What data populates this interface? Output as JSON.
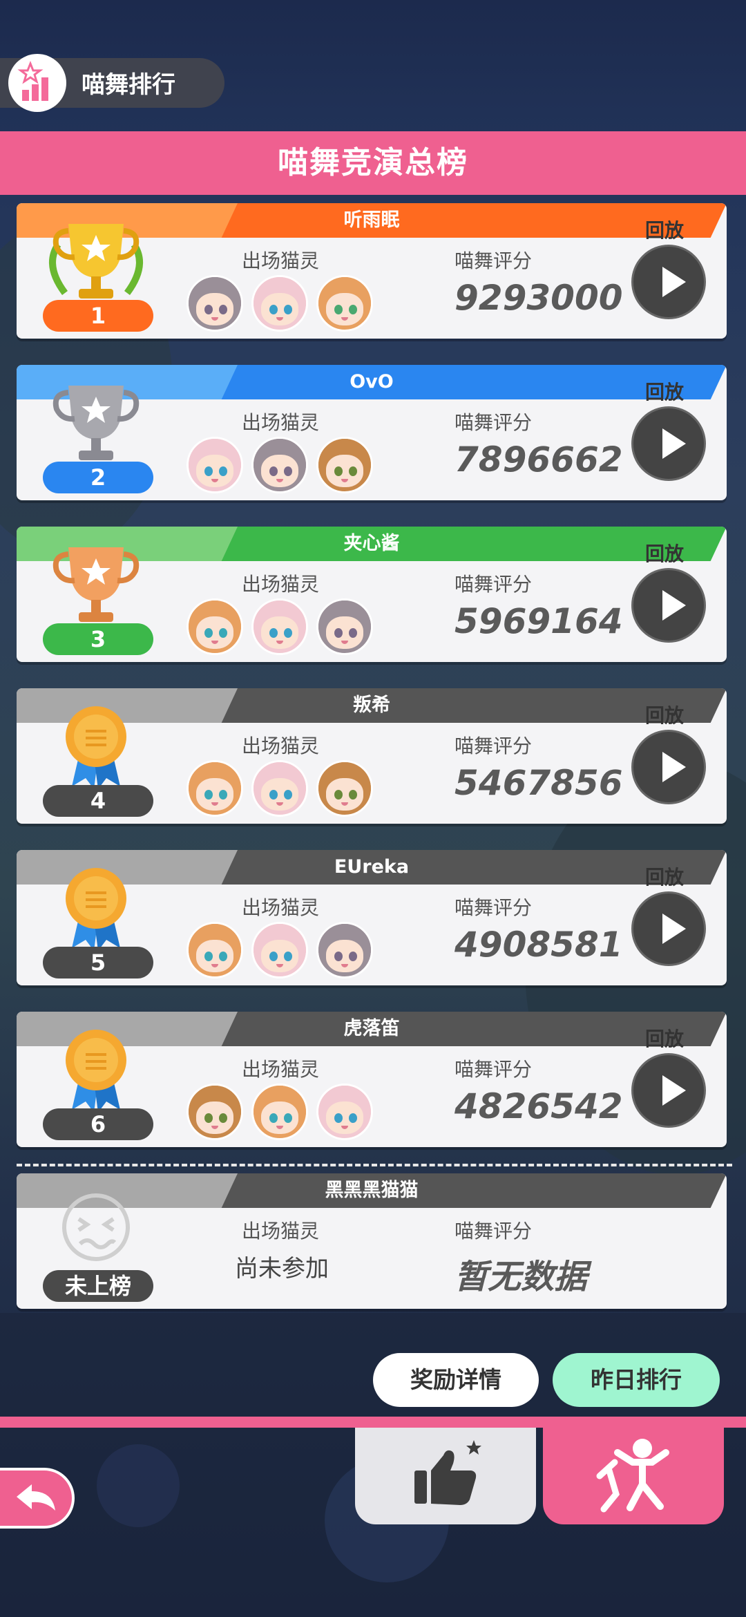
{
  "header": {
    "tag_label": "喵舞排行",
    "title": "喵舞竞演总榜"
  },
  "labels": {
    "team": "出场猫灵",
    "score": "喵舞评分",
    "replay": "回放"
  },
  "entries": [
    {
      "rank": "1",
      "name": "听雨眠",
      "score": "9293000",
      "band_light": "#ff9a4a",
      "band_dark": "#ff6a1f",
      "pill": "#ff6a1f",
      "medal": "gold-trophy-icon"
    },
    {
      "rank": "2",
      "name": "OvO",
      "score": "7896662",
      "band_light": "#5aaef8",
      "band_dark": "#2a86f0",
      "pill": "#2a86f0",
      "medal": "silver-trophy-icon"
    },
    {
      "rank": "3",
      "name": "夹心酱",
      "score": "5969164",
      "band_light": "#7ad07a",
      "band_dark": "#3cb84a",
      "pill": "#3cb84a",
      "medal": "bronze-trophy-icon"
    },
    {
      "rank": "4",
      "name": "叛希",
      "score": "5467856",
      "band_light": "#a8a8a8",
      "band_dark": "#555555",
      "pill": "#4a4a4a",
      "medal": "ribbon-medal-icon"
    },
    {
      "rank": "5",
      "name": "EUreka",
      "score": "4908581",
      "band_light": "#a8a8a8",
      "band_dark": "#555555",
      "pill": "#4a4a4a",
      "medal": "ribbon-medal-icon"
    },
    {
      "rank": "6",
      "name": "虎落笛",
      "score": "4826542",
      "band_light": "#a8a8a8",
      "band_dark": "#555555",
      "pill": "#4a4a4a",
      "medal": "ribbon-medal-icon"
    }
  ],
  "self_entry": {
    "rank": "未上榜",
    "name": "黑黑黑猫猫",
    "team_text": "尚未参加",
    "score_text": "暂无数据"
  },
  "buttons": {
    "reward": "奖励详情",
    "yesterday": "昨日排行"
  },
  "colors": {
    "accent_pink": "#ef6090",
    "mint": "#9ff5d0"
  }
}
